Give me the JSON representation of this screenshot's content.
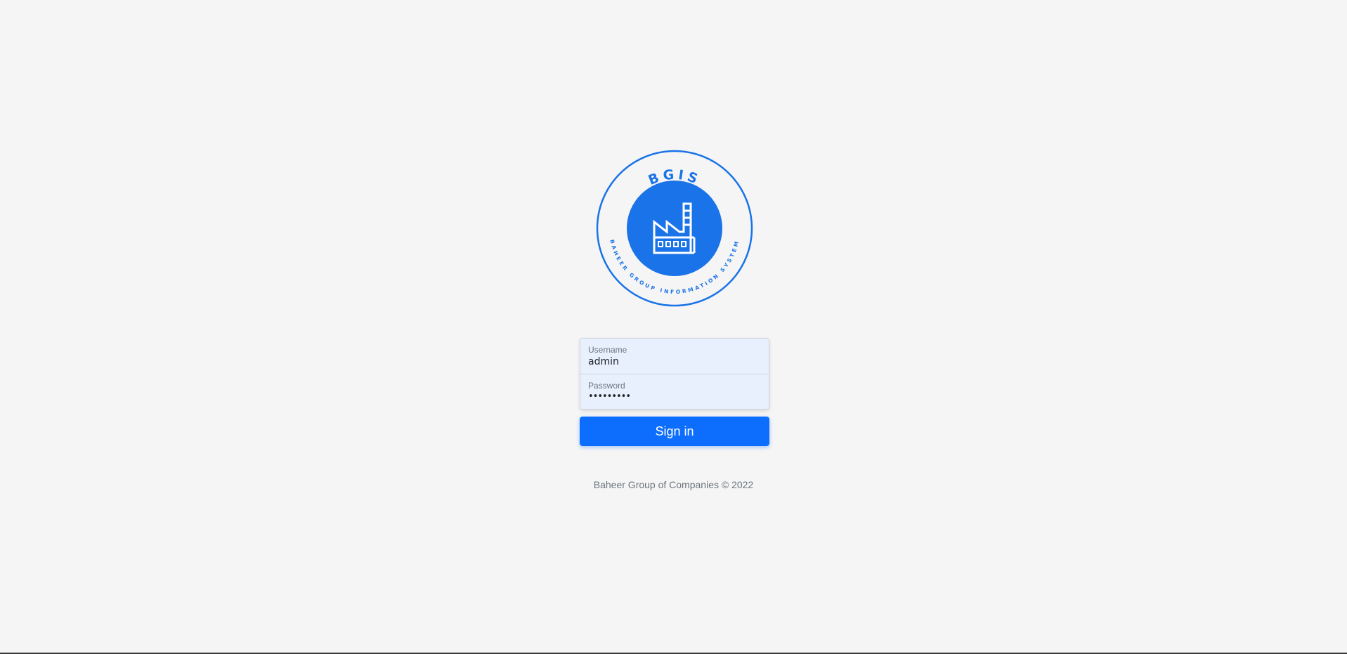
{
  "logo": {
    "acronym": "BGIS",
    "tagline": "BAHEER GROUP INFORMATION SYSTEM",
    "icon": "factory-icon",
    "color": "#1a73e8"
  },
  "form": {
    "username": {
      "label": "Username",
      "value": "admin"
    },
    "password": {
      "label": "Password",
      "masked_value": "•••••••••"
    },
    "signin_label": "Sign in"
  },
  "footer": {
    "text": "Baheer Group of Companies © 2022"
  },
  "colors": {
    "primary": "#0d6efd",
    "background": "#f5f5f5",
    "autofill": "#e8f0fe"
  }
}
